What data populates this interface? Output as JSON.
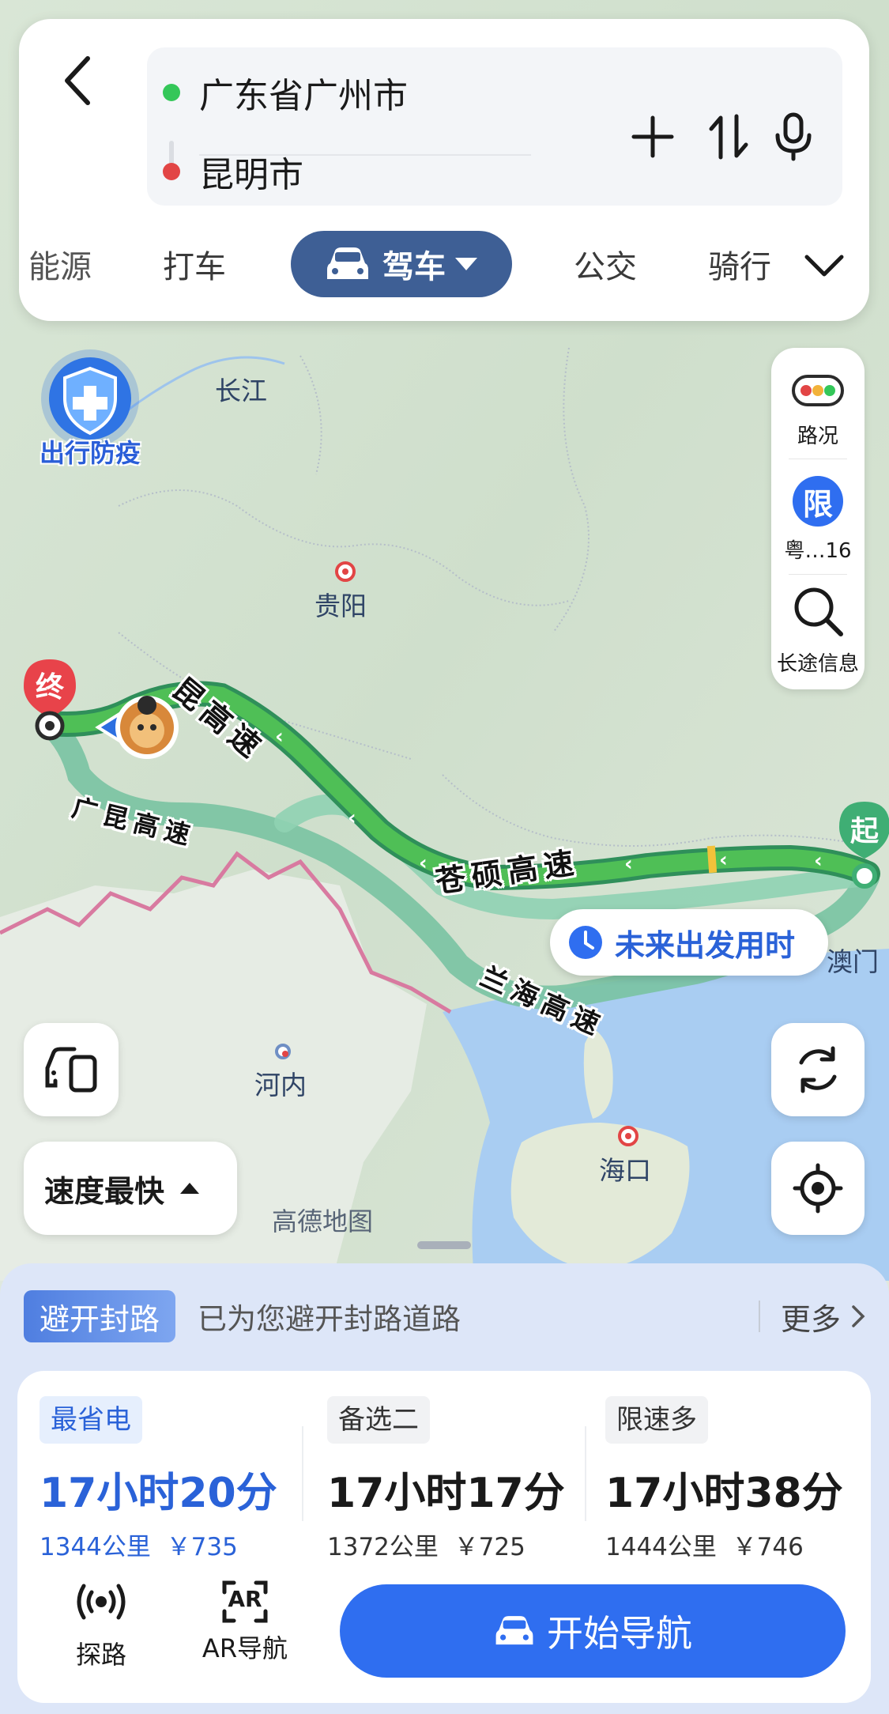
{
  "search": {
    "origin": "广东省广州市",
    "destination": "昆明市"
  },
  "tabs": [
    {
      "label": "能源"
    },
    {
      "label": "打车"
    },
    {
      "label": "驾车",
      "selected": true
    },
    {
      "label": "公交"
    },
    {
      "label": "骑行"
    }
  ],
  "map": {
    "epidemic_badge": "出行防疫",
    "labels": {
      "yangtze": "长江",
      "guiyang": "贵阳",
      "hanoi": "河内",
      "haikou": "海口",
      "macau": "澳门",
      "watermark": "高德地图"
    },
    "roads": {
      "kun_highway": "昆高速",
      "guangkun": "广昆高速",
      "cangshuo": "苍硕高速",
      "lanhai": "兰海高速"
    },
    "end_marker": "终",
    "start_marker": "起",
    "route_color": "#3da75c",
    "alt_route_color": "#7ec9a6"
  },
  "side_tools": {
    "traffic_label": "路况",
    "restrict_icon": "限",
    "restrict_label": "粤…16",
    "longtrip_label": "长途信息"
  },
  "future_departure": "未来出发用时",
  "speed_mode": "速度最快",
  "notice": {
    "badge": "避开封路",
    "text": "已为您避开封路道路",
    "more": "更多"
  },
  "routes": [
    {
      "tag": "最省电",
      "time": "17小时20分",
      "distance": "1344公里",
      "cost": "￥735",
      "selected": true
    },
    {
      "tag": "备选二",
      "time": "17小时17分",
      "distance": "1372公里",
      "cost": "￥725",
      "selected": false
    },
    {
      "tag": "限速多",
      "time": "17小时38分",
      "distance": "1444公里",
      "cost": "￥746",
      "selected": false
    }
  ],
  "bottom_tools": {
    "explore": "探路",
    "ar_nav": "AR导航",
    "ar_icon_text": "AR"
  },
  "start_button": "开始导航",
  "colors": {
    "accent": "#2f6ef0",
    "drive_tab": "#3e5f95"
  }
}
